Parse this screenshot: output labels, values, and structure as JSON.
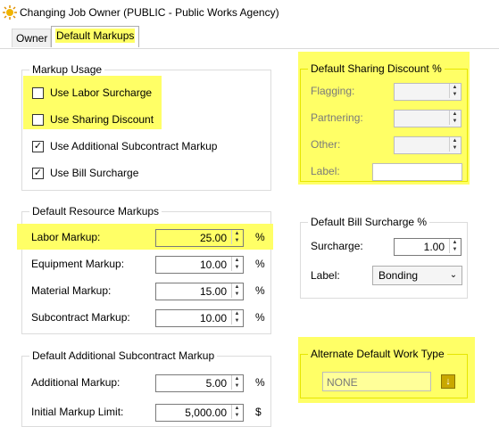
{
  "window": {
    "title": "Changing Job Owner  (PUBLIC - Public Works Agency)"
  },
  "tabs": [
    {
      "label": "Owner",
      "active": false
    },
    {
      "label": "Default Markups",
      "active": true
    }
  ],
  "markup_usage": {
    "title": "Markup Usage",
    "options": [
      {
        "label": "Use Labor Surcharge",
        "checked": false
      },
      {
        "label": "Use Sharing Discount",
        "checked": false
      },
      {
        "label": "Use Additional Subcontract Markup",
        "checked": true
      },
      {
        "label": "Use Bill Surcharge",
        "checked": true
      }
    ],
    "check_glyph": "✓"
  },
  "sharing_discount": {
    "title": "Default Sharing Discount %",
    "fields": [
      {
        "label": "Flagging:",
        "value": ""
      },
      {
        "label": "Partnering:",
        "value": ""
      },
      {
        "label": "Other:",
        "value": ""
      }
    ],
    "label_field": {
      "label": "Label:",
      "value": ""
    }
  },
  "resource_markups": {
    "title": "Default Resource Markups",
    "rows": [
      {
        "label": "Labor Markup:",
        "value": "25.00",
        "unit": "%"
      },
      {
        "label": "Equipment Markup:",
        "value": "10.00",
        "unit": "%"
      },
      {
        "label": "Material Markup:",
        "value": "15.00",
        "unit": "%"
      },
      {
        "label": "Subcontract Markup:",
        "value": "10.00",
        "unit": "%"
      }
    ]
  },
  "bill_surcharge": {
    "title": "Default Bill Surcharge %",
    "surcharge": {
      "label": "Surcharge:",
      "value": "1.00"
    },
    "label_select": {
      "label": "Label:",
      "value": "Bonding"
    }
  },
  "additional_subcontract": {
    "title": "Default Additional Subcontract Markup",
    "rows": [
      {
        "label": "Additional Markup:",
        "value": "5.00",
        "unit": "%"
      },
      {
        "label": "Initial Markup Limit:",
        "value": "5,000.00",
        "unit": "$"
      }
    ]
  },
  "work_type": {
    "title": "Alternate Default Work Type",
    "value": "NONE"
  },
  "colors": {
    "highlight": "#ffff66",
    "accent_icon": "#c9a800"
  }
}
